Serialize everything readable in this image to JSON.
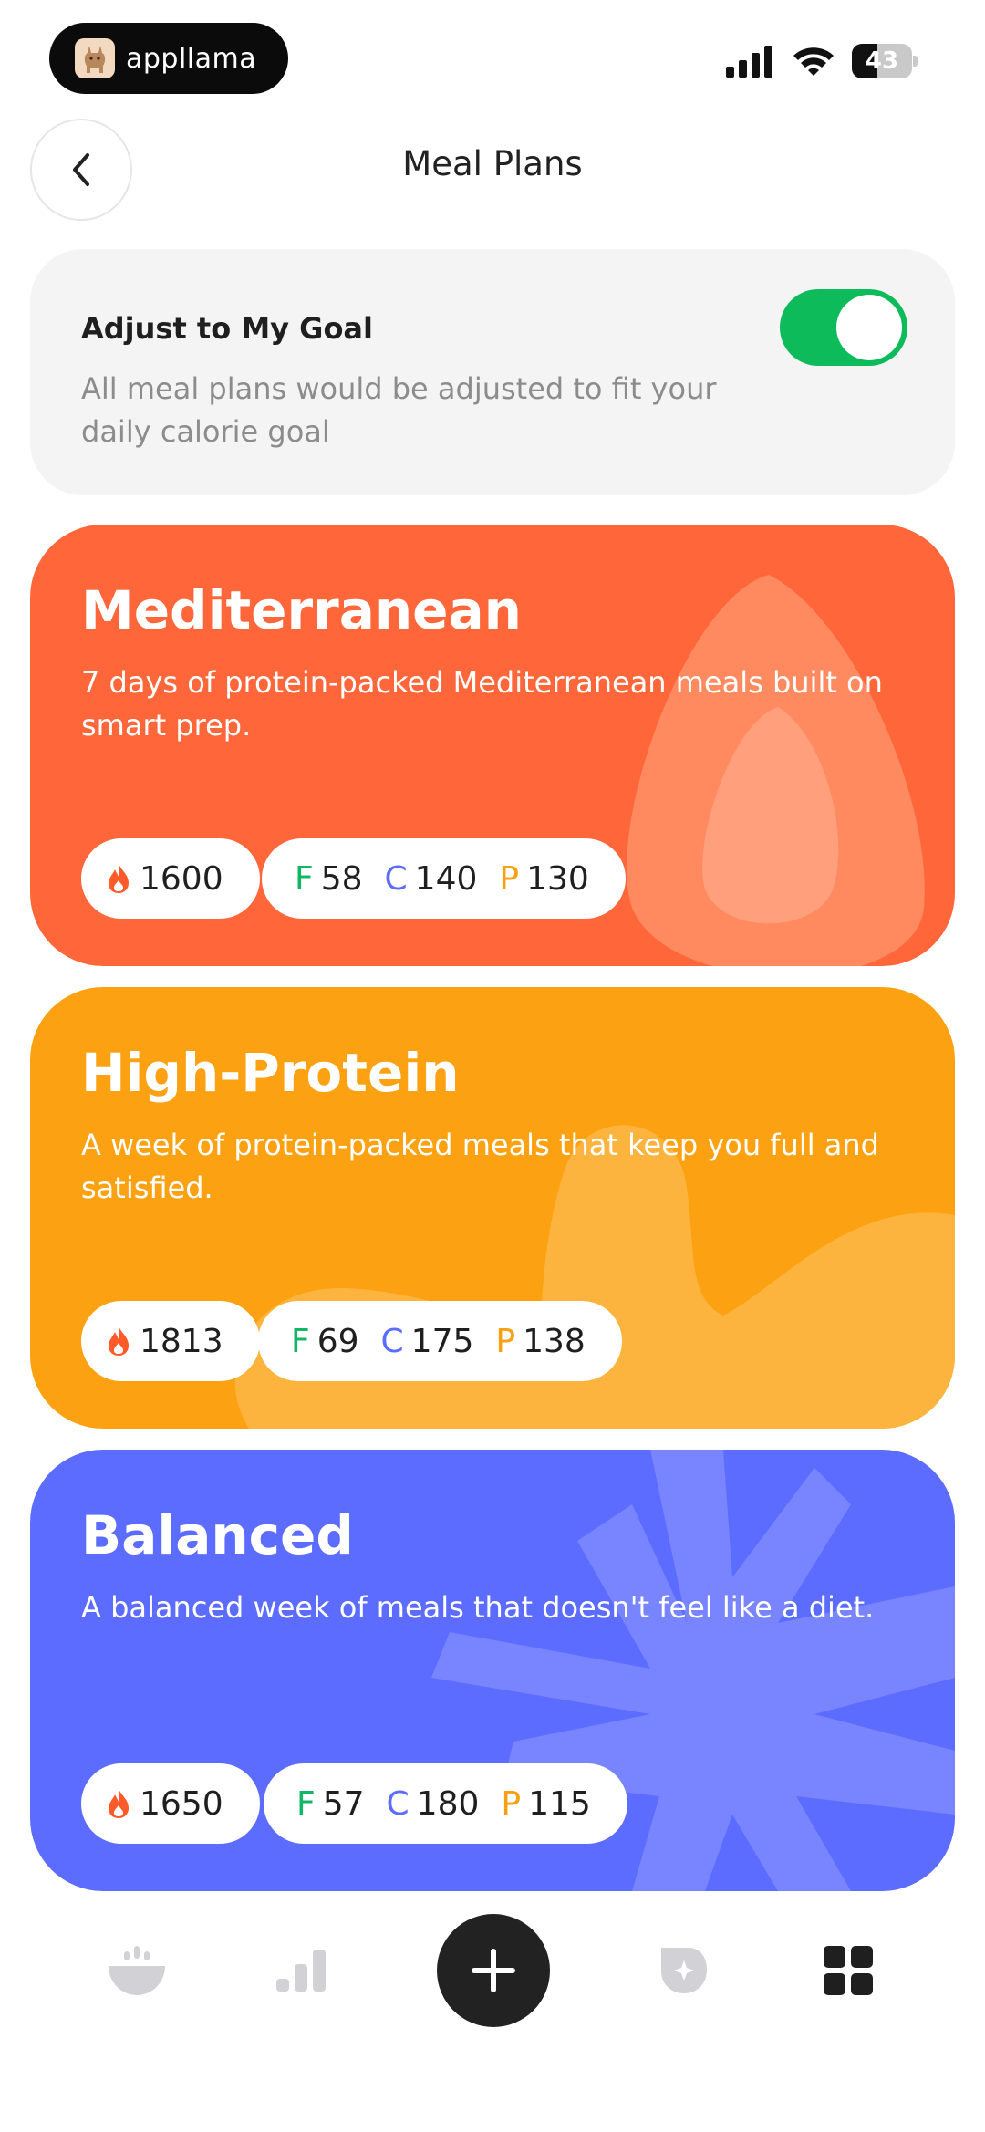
{
  "status_bar": {
    "brand": "appllama",
    "battery": "43",
    "battery_level": 0.43
  },
  "header": {
    "title": "Meal Plans",
    "back_icon": "chevron-left-icon"
  },
  "goal": {
    "title": "Adjust to My Goal",
    "description": "All meal plans would be adjusted to fit your daily calorie goal",
    "toggle_on": true,
    "toggle_color": "#0dbb5b"
  },
  "plans": [
    {
      "name": "Mediterranean",
      "description": "7 days of protein-packed Mediterranean meals built on smart prep.",
      "calories": "1600",
      "fat_label": "F",
      "fat": "58",
      "carbs_label": "C",
      "carbs": "140",
      "protein_label": "P",
      "protein": "130",
      "color": "#ff673a"
    },
    {
      "name": "High-Protein",
      "description": "A week of protein-packed meals that keep you full and satisfied.",
      "calories": "1813",
      "fat_label": "F",
      "fat": "69",
      "carbs_label": "C",
      "carbs": "175",
      "protein_label": "P",
      "protein": "138",
      "color": "#fca111"
    },
    {
      "name": "Balanced",
      "description": "A balanced week of meals that doesn't feel like a diet.",
      "calories": "1650",
      "fat_label": "F",
      "fat": "57",
      "carbs_label": "C",
      "carbs": "180",
      "protein_label": "P",
      "protein": "115",
      "color": "#5b6cff"
    }
  ],
  "bottom_nav": {
    "items": [
      {
        "icon": "bowl-icon"
      },
      {
        "icon": "bar-chart-icon"
      },
      {
        "icon": "plus-icon"
      },
      {
        "icon": "sparkle-badge-icon"
      },
      {
        "icon": "grid-icon"
      }
    ]
  }
}
